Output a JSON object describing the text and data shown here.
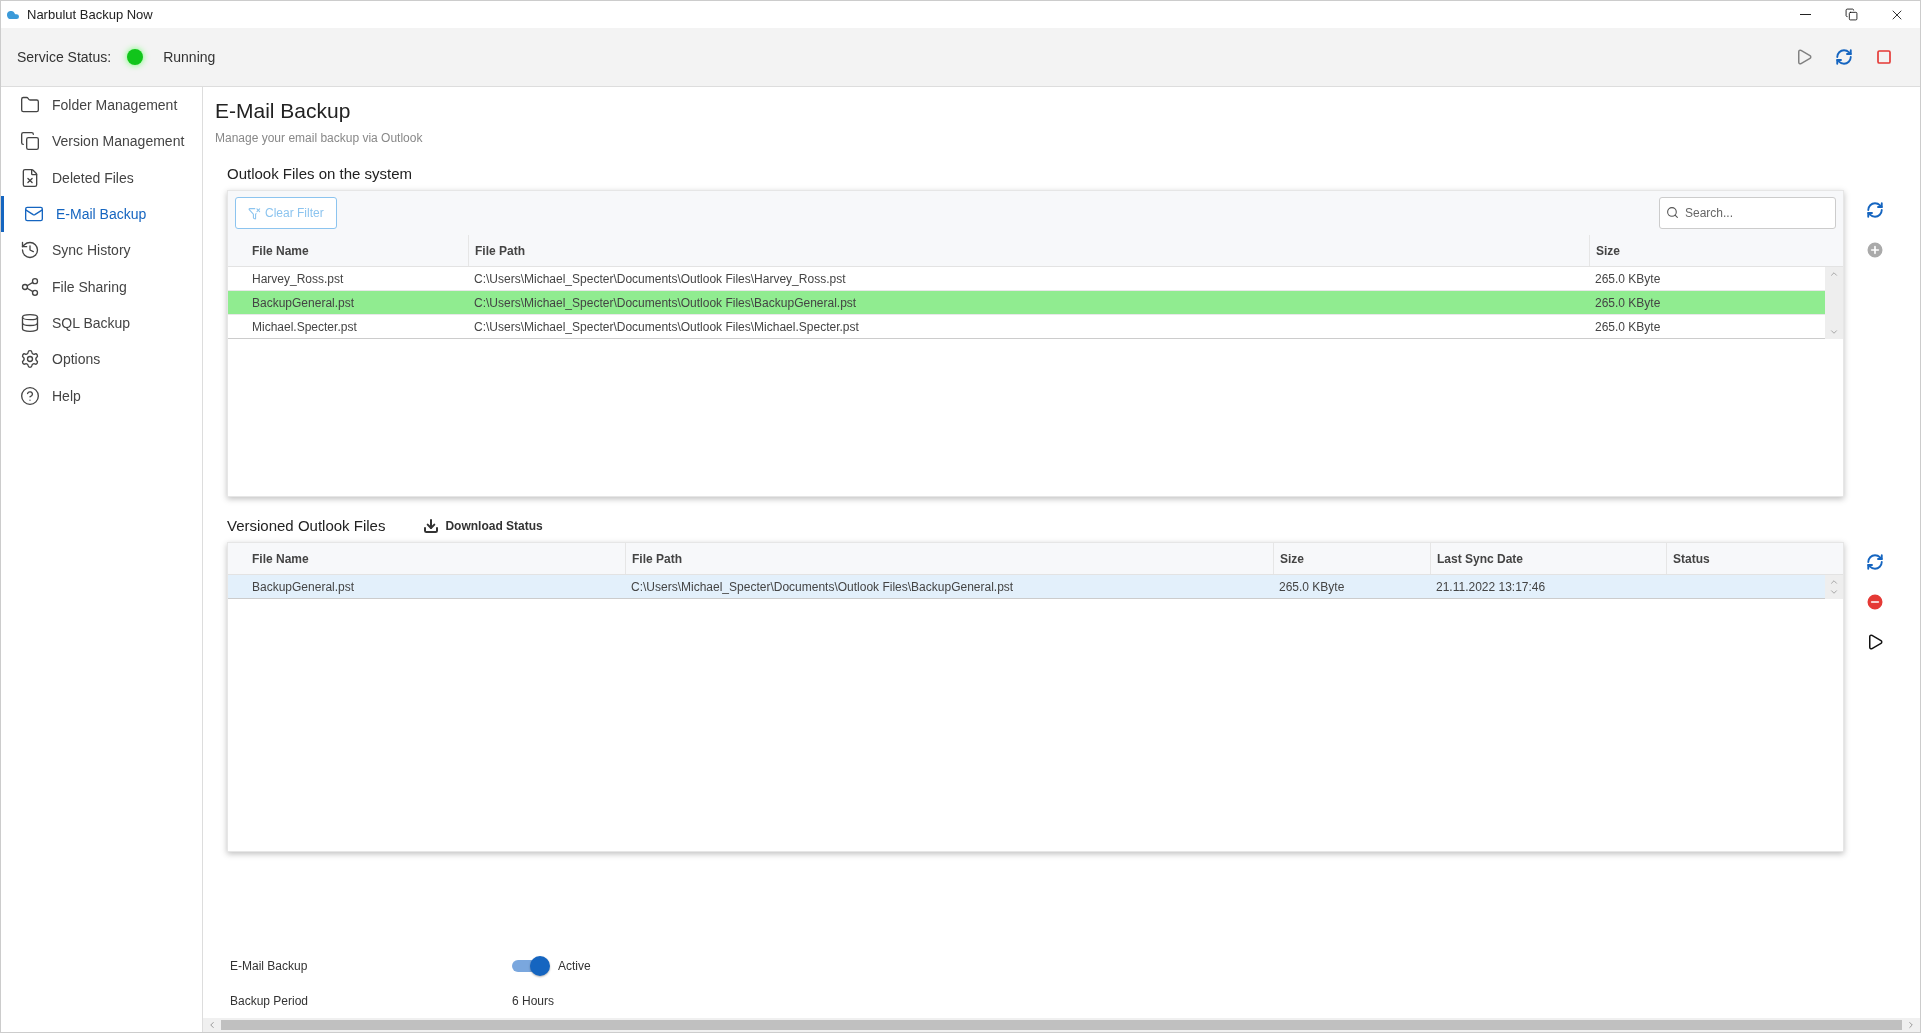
{
  "window": {
    "title": "Narbulut Backup Now"
  },
  "service_status": {
    "label": "Service Status:",
    "value": "Running",
    "running": true
  },
  "header_actions": [
    {
      "kind": "play",
      "disabled": true
    },
    {
      "kind": "refresh",
      "disabled": false
    },
    {
      "kind": "stop",
      "disabled": false
    }
  ],
  "sidebar": {
    "items": [
      {
        "label": "Folder Management",
        "selected": false
      },
      {
        "label": "Version Management",
        "selected": false
      },
      {
        "label": "Deleted Files",
        "selected": false
      },
      {
        "label": "E-Mail Backup",
        "selected": true
      },
      {
        "label": "Sync History",
        "selected": false
      },
      {
        "label": "File Sharing",
        "selected": false
      },
      {
        "label": "SQL Backup",
        "selected": false
      },
      {
        "label": "Options",
        "selected": false
      },
      {
        "label": "Help",
        "selected": false
      }
    ]
  },
  "page": {
    "title": "E-Mail Backup",
    "subtitle": "Manage your email backup via Outlook"
  },
  "outlook_files": {
    "title": "Outlook Files on the system",
    "clear_filter": "Clear Filter",
    "search": {
      "placeholder": "Search..."
    },
    "side_actions": [
      {
        "kind": "refresh"
      },
      {
        "kind": "add"
      }
    ],
    "columns": [
      "File Name",
      "File Path",
      "Size"
    ],
    "rows": [
      {
        "cells": [
          "Harvey_Ross.pst",
          "C:\\Users\\Michael_Specter\\Documents\\Outlook Files\\Harvey_Ross.pst",
          "265.0 KByte"
        ],
        "selected": false
      },
      {
        "cells": [
          "BackupGeneral.pst",
          "C:\\Users\\Michael_Specter\\Documents\\Outlook Files\\BackupGeneral.pst",
          "265.0 KByte"
        ],
        "selected": true
      },
      {
        "cells": [
          "Michael.Specter.pst",
          "C:\\Users\\Michael_Specter\\Documents\\Outlook Files\\Michael.Specter.pst",
          "265.0 KByte"
        ],
        "selected": false
      }
    ]
  },
  "versioned_files": {
    "title": "Versioned Outlook Files",
    "download_status": "Download Status",
    "side_actions": [
      {
        "kind": "refresh"
      },
      {
        "kind": "remove"
      },
      {
        "kind": "play"
      }
    ],
    "columns": [
      "File Name",
      "File Path",
      "Size",
      "Last Sync Date",
      "Status"
    ],
    "rows": [
      {
        "cells": [
          "BackupGeneral.pst",
          "C:\\Users\\Michael_Specter\\Documents\\Outlook Files\\BackupGeneral.pst",
          "265.0 KByte",
          "21.11.2022 13:17:46",
          ""
        ],
        "selected": true
      }
    ]
  },
  "settings": [
    {
      "kind": "toggle",
      "label": "E-Mail Backup",
      "on": true,
      "value": "Active"
    },
    {
      "kind": "text",
      "label": "Backup Period",
      "value": "6 Hours"
    }
  ]
}
